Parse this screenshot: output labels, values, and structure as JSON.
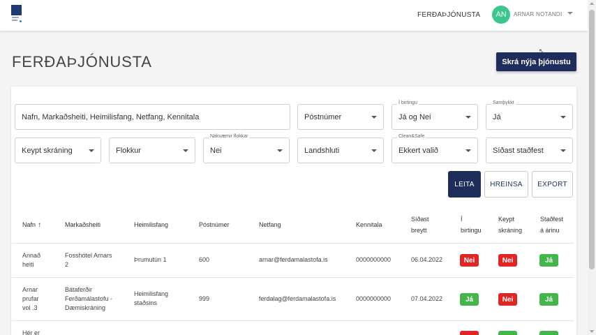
{
  "header": {
    "nav_link": "FERÐAÞJÓNUSTA",
    "avatar_initials": "AN",
    "user_name": "ARNAR NOTANDI"
  },
  "page": {
    "title": "FERÐAÞJÓNUSTA",
    "create_button": "Skrá nýja þjónustu"
  },
  "filters": {
    "search_placeholder": "Nafn, Markaðsheiti, Heimilisfang, Netfang, Kennitala",
    "postnumer": "Póstnúmer",
    "birtingu_label": "Í birtingu",
    "birtingu_value": "Já og Nei",
    "samthykkt_label": "Samþykkt",
    "samthykkt_value": "Já",
    "keypt": "Keypt skráning",
    "flokkur": "Flokkur",
    "nakvaemir_label": "Nákvæmir flokkar",
    "nakvaemir_value": "Nei",
    "landshluti": "Landshluti",
    "clean_label": "Clean&Safe",
    "clean_value": "Ekkert valið",
    "stadfest": "Síðast staðfest"
  },
  "buttons": {
    "search": "LEITA",
    "clear": "HREINSA",
    "export": "EXPORT"
  },
  "table": {
    "headers": {
      "nafn": "Nafn",
      "markadsheiti": "Markaðsheiti",
      "heimilisfang": "Heimilisfang",
      "postnumer": "Póstnúmer",
      "netfang": "Netfang",
      "kennitala": "Kennitala",
      "breytt_1": "Síðast",
      "breytt_2": "breytt",
      "birtingu_1": "Í",
      "birtingu_2": "birtingu",
      "keypt_1": "Keypt",
      "keypt_2": "skráning",
      "stadfest_1": "Staðfest",
      "stadfest_2": "á árinu"
    },
    "rows": [
      {
        "nafn_1": "Annað",
        "nafn_2": "heiti",
        "markadsheiti_1": "Fosshótel Arnars",
        "markadsheiti_2": "2",
        "heimilisfang_1": "Þrumutún 1",
        "postnumer": "600",
        "netfang": "arnar@ferdamalastofa.is",
        "kennitala": "0000000000",
        "breytt": "06.04.2022",
        "birtingu": "Nei",
        "keypt": "Nei",
        "stadfest": "Já"
      },
      {
        "nafn_1": "Arnar",
        "nafn_2": "prufar",
        "nafn_3": "vol .3",
        "markadsheiti_1": "Bátaferðir",
        "markadsheiti_2": "Ferðamálastofu -",
        "markadsheiti_3": "Dæmiskráning",
        "heimilisfang_1": "Heimilisfang",
        "heimilisfang_2": "staðsins",
        "postnumer": "999",
        "netfang": "ferdalag@ferdamalastofa.is",
        "kennitala": "0000000000",
        "breytt": "07.04.2022",
        "birtingu": "Já",
        "keypt": "Nei",
        "stadfest": "Já"
      },
      {
        "nafn_1": "Hér er"
      }
    ]
  },
  "colors": {
    "primary": "#1e2d5c",
    "avatar": "#3cc58c",
    "badge_no": "#e02525",
    "badge_yes": "#43b649"
  }
}
